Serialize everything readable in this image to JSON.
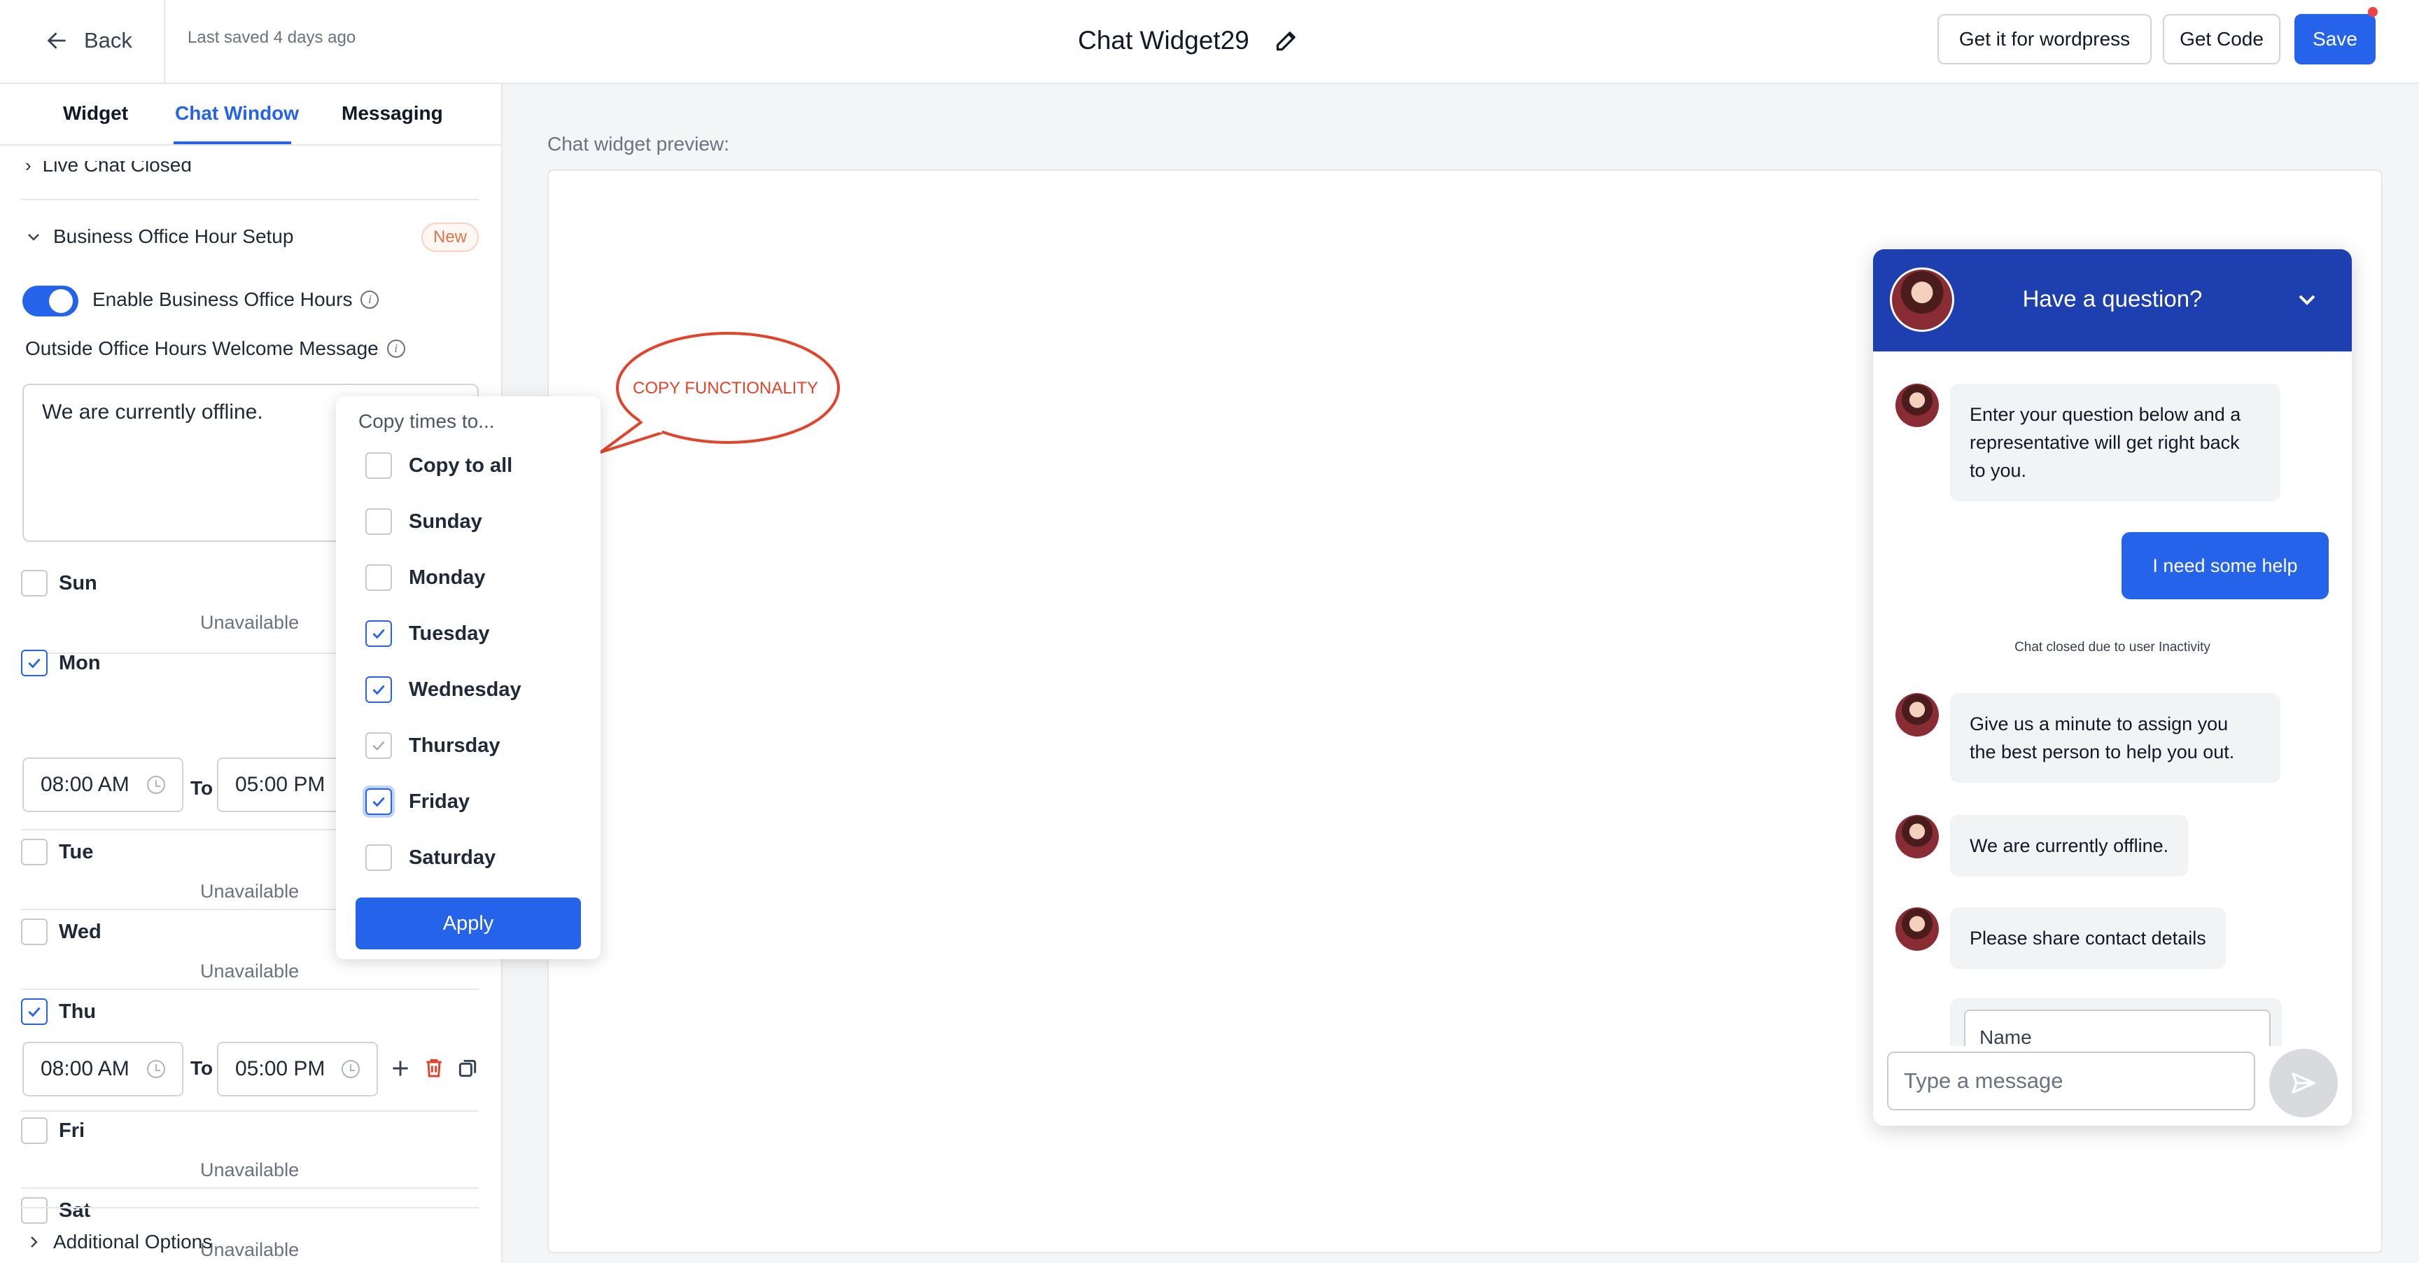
{
  "header": {
    "back_label": "Back",
    "last_saved": "Last saved 4 days ago",
    "title": "Chat Widget29",
    "wordpress_label": "Get it for wordpress",
    "get_code_label": "Get Code",
    "save_label": "Save"
  },
  "tabs": [
    {
      "label": "Widget",
      "active": false
    },
    {
      "label": "Chat Window",
      "active": true
    },
    {
      "label": "Messaging",
      "active": false
    }
  ],
  "sections": {
    "live_chat_closed": "Live Chat Closed",
    "business_hours": "Business Office Hour Setup",
    "new_badge": "New",
    "enable_label": "Enable Business Office Hours",
    "enable_on": true,
    "outside_msg_label": "Outside Office Hours Welcome Message",
    "outside_msg_value": "We are currently offline.",
    "additional_options": "Additional Options"
  },
  "schedule": {
    "to_label": "To",
    "unavailable": "Unavailable",
    "days": [
      {
        "label": "Sun",
        "checked": false
      },
      {
        "label": "Mon",
        "checked": true,
        "from": "08:00 AM",
        "to": "05:00 PM"
      },
      {
        "label": "Tue",
        "checked": false
      },
      {
        "label": "Wed",
        "checked": false
      },
      {
        "label": "Thu",
        "checked": true,
        "from": "08:00 AM",
        "to": "05:00 PM"
      },
      {
        "label": "Fri",
        "checked": false
      },
      {
        "label": "Sat",
        "checked": false
      }
    ]
  },
  "copy_popup": {
    "title": "Copy times to...",
    "options": [
      {
        "label": "Copy to all",
        "checked": false
      },
      {
        "label": "Sunday",
        "checked": false
      },
      {
        "label": "Monday",
        "checked": false
      },
      {
        "label": "Tuesday",
        "checked": true
      },
      {
        "label": "Wednesday",
        "checked": true
      },
      {
        "label": "Thursday",
        "checked": true,
        "disabled": true
      },
      {
        "label": "Friday",
        "checked": true,
        "focused": true
      },
      {
        "label": "Saturday",
        "checked": false
      }
    ],
    "apply_label": "Apply"
  },
  "callout": {
    "text": "COPY FUNCTIONALITY",
    "color": "#e0452b"
  },
  "preview": {
    "label": "Chat widget preview:",
    "chat_title": "Have a question?",
    "bot_msg_1": [
      "Enter your question below and a",
      "representative will get right back",
      "to you."
    ],
    "user_msg": "I need some help",
    "chat_closed": "Chat closed due to user Inactivity",
    "bot_msg_2": [
      "Give us a minute to assign you",
      "the best person to help you out."
    ],
    "bot_msg_3": "We are currently offline.",
    "bot_msg_4": "Please share contact details",
    "name_placeholder": "Name",
    "message_placeholder": "Type a message"
  },
  "colors": {
    "accent": "#2563eb",
    "header_blue": "#1e3faf",
    "badge": "#e0764f"
  }
}
